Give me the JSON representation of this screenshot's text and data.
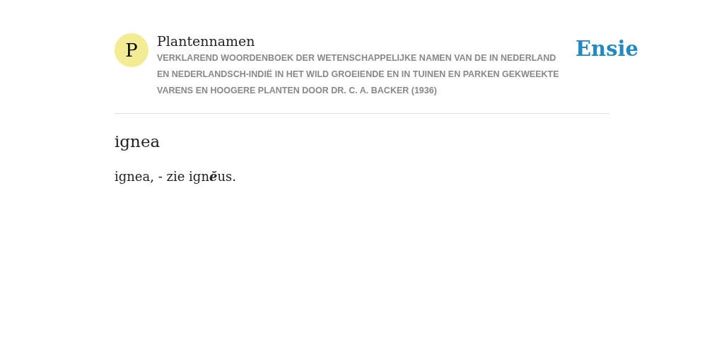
{
  "header": {
    "logo_letter": "P",
    "title": "Plantennamen",
    "subtitle": "VERKLAREND WOORDENBOEK DER WETENSCHAPPELIJKE NAMEN VAN DE IN NEDERLAND EN NEDERLANDSCH-INDIË IN HET WILD GROEIENDE EN IN TUINEN EN PARKEN GEKWEEKTE VARENS EN HOOGERE PLANTEN DOOR DR. C. A. BACKER (1936)",
    "brand": "Ensie"
  },
  "entry": {
    "heading": "ignea",
    "definition": "ignea, - zie ign**ĕ**us."
  }
}
